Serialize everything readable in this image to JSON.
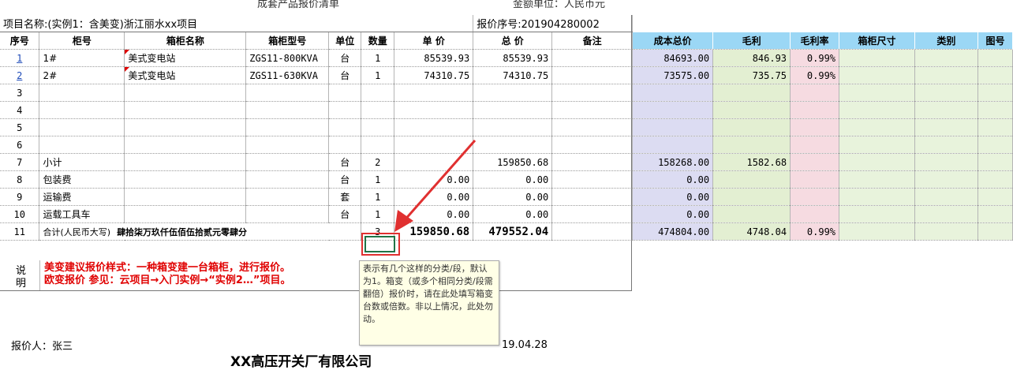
{
  "top_cut": {
    "left": "成套产品报价清单",
    "right": "金额单位：人民币元"
  },
  "project": {
    "name": "项目名称:(实例1：含美变)浙江丽水xx项目",
    "quote_no": "报价序号:201904280002"
  },
  "columns": [
    "序号",
    "柜号",
    "箱柜名称",
    "箱柜型号",
    "单位",
    "数量",
    "单  价",
    "总  价",
    "备注",
    "成本总价",
    "毛利",
    "毛利率",
    "箱柜尺寸",
    "类别",
    "图号"
  ],
  "rows": [
    {
      "no": "1",
      "cab": "1#",
      "name": "美式变电站",
      "model": "ZGS11-800KVA",
      "unit": "台",
      "qty": "1",
      "price": "85539.93",
      "total": "85539.93",
      "note": "",
      "cost": "84693.00",
      "profit": "846.93",
      "rate": "0.99%"
    },
    {
      "no": "2",
      "cab": "2#",
      "name": "美式变电站",
      "model": "ZGS11-630KVA",
      "unit": "台",
      "qty": "1",
      "price": "74310.75",
      "total": "74310.75",
      "note": "",
      "cost": "73575.00",
      "profit": "735.75",
      "rate": "0.99%"
    },
    {
      "no": "3",
      "cab": "",
      "name": "",
      "model": "",
      "unit": "",
      "qty": "",
      "price": "",
      "total": "",
      "note": "",
      "cost": "",
      "profit": "",
      "rate": ""
    },
    {
      "no": "4",
      "cab": "",
      "name": "",
      "model": "",
      "unit": "",
      "qty": "",
      "price": "",
      "total": "",
      "note": "",
      "cost": "",
      "profit": "",
      "rate": ""
    },
    {
      "no": "5",
      "cab": "",
      "name": "",
      "model": "",
      "unit": "",
      "qty": "",
      "price": "",
      "total": "",
      "note": "",
      "cost": "",
      "profit": "",
      "rate": ""
    },
    {
      "no": "6",
      "cab": "",
      "name": "",
      "model": "",
      "unit": "",
      "qty": "",
      "price": "",
      "total": "",
      "note": "",
      "cost": "",
      "profit": "",
      "rate": ""
    },
    {
      "no": "7",
      "cab": "小计",
      "name": "",
      "model": "",
      "unit": "台",
      "qty": "2",
      "price": "",
      "total": "159850.68",
      "note": "",
      "cost": "158268.00",
      "profit": "1582.68",
      "rate": ""
    },
    {
      "no": "8",
      "cab": "包装费",
      "name": "",
      "model": "",
      "unit": "台",
      "qty": "1",
      "price": "0.00",
      "total": "0.00",
      "note": "",
      "cost": "0.00",
      "profit": "",
      "rate": ""
    },
    {
      "no": "9",
      "cab": "运输费",
      "name": "",
      "model": "",
      "unit": "套",
      "qty": "1",
      "price": "0.00",
      "total": "0.00",
      "note": "",
      "cost": "0.00",
      "profit": "",
      "rate": ""
    },
    {
      "no": "10",
      "cab": "运载工具车",
      "name": "",
      "model": "",
      "unit": "台",
      "qty": "1",
      "price": "0.00",
      "total": "0.00",
      "note": "",
      "cost": "0.00",
      "profit": "",
      "rate": ""
    }
  ],
  "total_row": {
    "no": "11",
    "label": "合计(人民币大写)",
    "amount_words": "肆拾柒万玖仟伍佰伍拾贰元零肆分",
    "qty": "3",
    "price": "159850.68",
    "total": "479552.04",
    "cost": "474804.00",
    "profit": "4748.04",
    "rate": "0.99%"
  },
  "notes": {
    "label_1": "说",
    "label_2": "明",
    "line1": "美变建议报价样式：一种箱变建一台箱柜，进行报价。",
    "line2": "欧变报价 参见：云项目→入门实例→“实例2…”项目。"
  },
  "tooltip": "表示有几个这样的分类/段，默认为1。箱变（或多个相同分类/段需翻倍）报价时，请在此处填写箱变台数或倍数。非以上情况，此处勿动。",
  "footer": {
    "quoter": "报价人：张三",
    "date": "19.04.28",
    "company": "XX高压开关厂有限公司"
  },
  "colors": {
    "header_blue": "#9bd7f5",
    "arrow_red": "#e03030",
    "note_red": "#e00000"
  }
}
